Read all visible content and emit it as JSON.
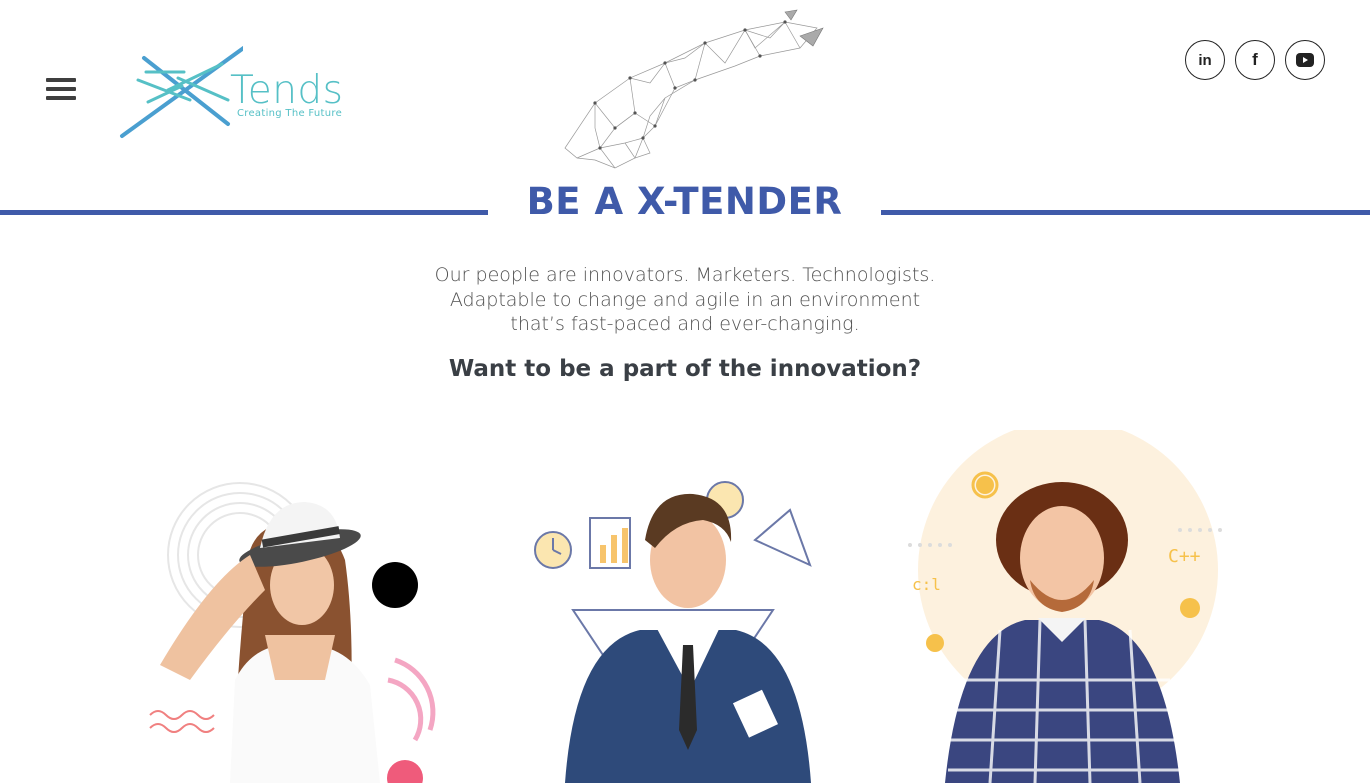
{
  "header": {
    "menu_icon": "hamburger-menu-icon",
    "logo": {
      "wordmark": "Tends",
      "tagline": "Creating The Future",
      "mark_icon": "x-logo-icon",
      "color": "#56c0c6",
      "mark_color": "#4a9fd0"
    },
    "hero_icon": "wireframe-hand-icon",
    "social": [
      {
        "name": "linkedin",
        "glyph": "in",
        "icon": "linkedin-icon"
      },
      {
        "name": "facebook",
        "glyph": "f",
        "icon": "facebook-icon"
      },
      {
        "name": "youtube",
        "glyph": "",
        "icon": "youtube-icon"
      }
    ]
  },
  "main": {
    "title": "BE A X-TENDER",
    "intro_lines": [
      "Our people are innovators. Marketers. Technologists.",
      "Adaptable to change and agile in an environment",
      "that’s fast-paced and ever-changing."
    ],
    "cta": "Want to be a part of the innovation?"
  },
  "people": [
    {
      "name": "woman-in-hat",
      "icon": "person-photo-woman"
    },
    {
      "name": "man-in-suit",
      "icon": "person-photo-businessman"
    },
    {
      "name": "man-in-plaid",
      "icon": "person-photo-developer"
    }
  ],
  "colors": {
    "accent": "#3f5aa9",
    "teal": "#56c0c6",
    "text": "#505050",
    "heading_dark": "#3a3f45"
  }
}
